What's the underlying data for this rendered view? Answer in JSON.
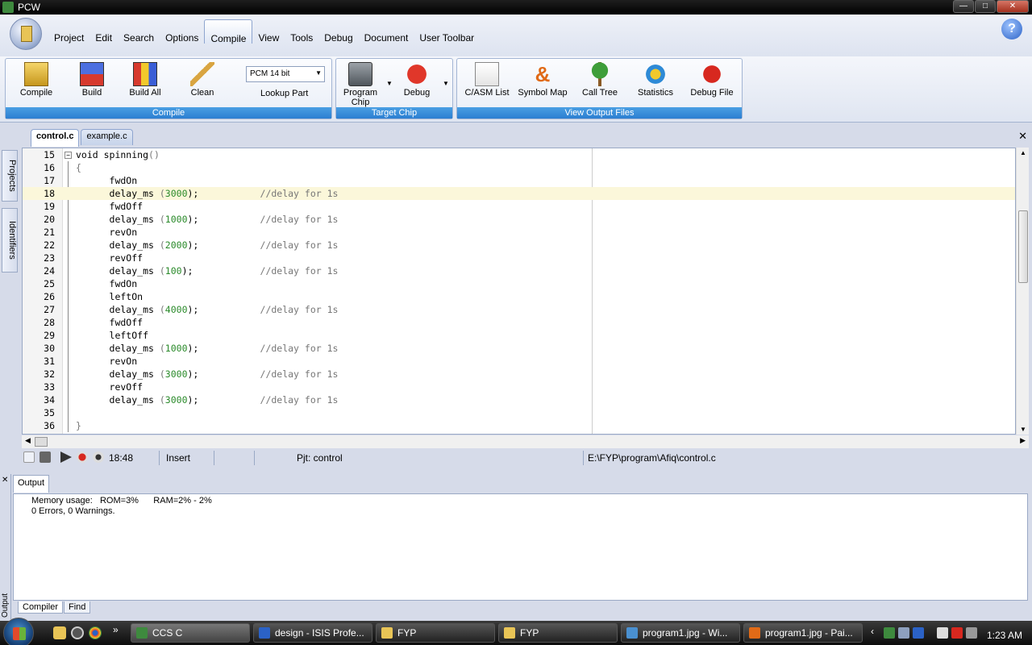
{
  "window": {
    "title": "PCW"
  },
  "menu": {
    "items": [
      "Project",
      "Edit",
      "Search",
      "Options",
      "Compile",
      "View",
      "Tools",
      "Debug",
      "Document",
      "User Toolbar"
    ],
    "active": "Compile"
  },
  "ribbon": {
    "compile_group": {
      "label": "Compile",
      "buttons": {
        "compile": "Compile",
        "build": "Build",
        "build_all": "Build All",
        "clean": "Clean"
      },
      "chip_select": "PCM 14 bit",
      "lookup_part": "Lookup Part"
    },
    "target_group": {
      "label": "Target Chip",
      "program_chip_line1": "Program",
      "program_chip_line2": "Chip",
      "debug": "Debug"
    },
    "output_group": {
      "label": "View Output Files",
      "buttons": {
        "casm": "C/ASM List",
        "symbol_map": "Symbol Map",
        "call_tree": "Call Tree",
        "statistics": "Statistics",
        "debug_file": "Debug File"
      }
    }
  },
  "side_tabs": {
    "projects": "Projects",
    "identifiers": "Identifiers"
  },
  "file_tabs": [
    {
      "label": "control.c",
      "active": true
    },
    {
      "label": "example.c",
      "active": false
    }
  ],
  "editor": {
    "lines": [
      {
        "n": "15",
        "pre": "void spinning",
        "num": "",
        "post": "",
        "paren": "()",
        "cmt": ""
      },
      {
        "n": "16",
        "pre": "",
        "num": "",
        "post": "",
        "paren": "{",
        "cmt": ""
      },
      {
        "n": "17",
        "pre": "      fwdOn",
        "num": "",
        "post": "",
        "paren": "",
        "cmt": ""
      },
      {
        "n": "18",
        "pre": "      delay_ms ",
        "paren": "(",
        "num": "3000",
        "post": ");",
        "cmt": "           //delay for 1s"
      },
      {
        "n": "19",
        "pre": "      fwdOff",
        "num": "",
        "post": "",
        "paren": "",
        "cmt": ""
      },
      {
        "n": "20",
        "pre": "      delay_ms ",
        "paren": "(",
        "num": "1000",
        "post": ");",
        "cmt": "           //delay for 1s"
      },
      {
        "n": "21",
        "pre": "      revOn",
        "num": "",
        "post": "",
        "paren": "",
        "cmt": ""
      },
      {
        "n": "22",
        "pre": "      delay_ms ",
        "paren": "(",
        "num": "2000",
        "post": ");",
        "cmt": "           //delay for 1s"
      },
      {
        "n": "23",
        "pre": "      revOff",
        "num": "",
        "post": "",
        "paren": "",
        "cmt": ""
      },
      {
        "n": "24",
        "pre": "      delay_ms ",
        "paren": "(",
        "num": "100",
        "post": ");",
        "cmt": "            //delay for 1s"
      },
      {
        "n": "25",
        "pre": "      fwdOn",
        "num": "",
        "post": "",
        "paren": "",
        "cmt": ""
      },
      {
        "n": "26",
        "pre": "      leftOn",
        "num": "",
        "post": "",
        "paren": "",
        "cmt": ""
      },
      {
        "n": "27",
        "pre": "      delay_ms ",
        "paren": "(",
        "num": "4000",
        "post": ");",
        "cmt": "           //delay for 1s"
      },
      {
        "n": "28",
        "pre": "      fwdOff",
        "num": "",
        "post": "",
        "paren": "",
        "cmt": ""
      },
      {
        "n": "29",
        "pre": "      leftOff",
        "num": "",
        "post": "",
        "paren": "",
        "cmt": ""
      },
      {
        "n": "30",
        "pre": "      delay_ms ",
        "paren": "(",
        "num": "1000",
        "post": ");",
        "cmt": "           //delay for 1s"
      },
      {
        "n": "31",
        "pre": "      revOn",
        "num": "",
        "post": "",
        "paren": "",
        "cmt": ""
      },
      {
        "n": "32",
        "pre": "      delay_ms ",
        "paren": "(",
        "num": "3000",
        "post": ");",
        "cmt": "           //delay for 1s"
      },
      {
        "n": "33",
        "pre": "      revOff",
        "num": "",
        "post": "",
        "paren": "",
        "cmt": ""
      },
      {
        "n": "34",
        "pre": "      delay_ms ",
        "paren": "(",
        "num": "3000",
        "post": ");",
        "cmt": "           //delay for 1s"
      },
      {
        "n": "35",
        "pre": "",
        "num": "",
        "post": "",
        "paren": "",
        "cmt": ""
      },
      {
        "n": "36",
        "pre": "",
        "num": "",
        "post": "",
        "paren": "}",
        "cmt": ""
      }
    ],
    "highlighted_line": "18"
  },
  "status": {
    "position": "18:48",
    "mode": "Insert",
    "project": "Pjt: control",
    "path": "E:\\FYP\\program\\Afiq\\control.c"
  },
  "output": {
    "tab_label": "Output",
    "side_label": "Output",
    "lines": [
      "Memory usage:   ROM=3%      RAM=2% - 2%",
      "0 Errors,  0 Warnings."
    ],
    "bottom_tabs": [
      "Compiler",
      "Find"
    ]
  },
  "taskbar": {
    "tasks": [
      {
        "label": "CCS C",
        "color": "#3e8a3e",
        "active": true
      },
      {
        "label": "design - ISIS Profe...",
        "color": "#2b62c6",
        "active": false
      },
      {
        "label": "FYP",
        "color": "#e8c456",
        "active": false
      },
      {
        "label": "FYP",
        "color": "#e8c456",
        "active": false
      },
      {
        "label": "program1.jpg - Wi...",
        "color": "#4a90d0",
        "active": false
      },
      {
        "label": "program1.jpg - Pai...",
        "color": "#e06a17",
        "active": false
      }
    ],
    "clock": "1:23 AM"
  }
}
